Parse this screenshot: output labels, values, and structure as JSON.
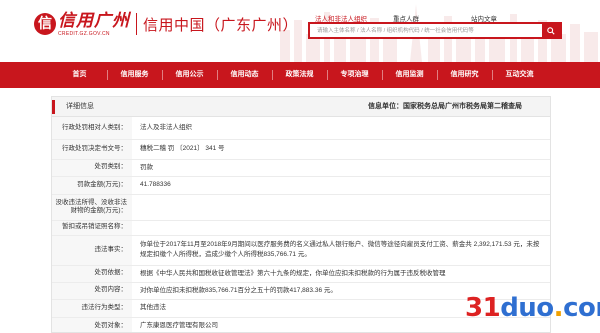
{
  "logo": {
    "badge": "信",
    "main": "信用广州",
    "sub": "CREDIT.GZ.GOV.CN",
    "site_name": "信用中国（广东广州）"
  },
  "search": {
    "tabs": [
      "法人和非法人组织",
      "重点人群",
      "站内文章"
    ],
    "placeholder": "请输入主体名称 / 法人名称 / 组织机构代码 / 统一社会信用代码等"
  },
  "nav": {
    "items": [
      "首页",
      "信用服务",
      "信用公示",
      "信用动态",
      "政策法规",
      "专项治理",
      "信用监测",
      "信用研究",
      "互动交流"
    ]
  },
  "detail": {
    "title": "详细信息",
    "source": "信息单位：国家税务总局广州市税务局第二稽查局",
    "rows": [
      {
        "label": "行政处罚相对人类别：",
        "value": "法人及非法人组织"
      },
      {
        "label": "行政处罚决定书文号：",
        "value": "穗税二稽 罚 〔2021〕 341 号"
      },
      {
        "label": "处罚类别：",
        "value": "罚款"
      },
      {
        "label": "罚款金额(万元)：",
        "value": "41.788336"
      },
      {
        "label": "没收违法所得、没收非法财物的金额(万元)：",
        "value": ""
      },
      {
        "label": "暂扣或吊销证照名称：",
        "value": ""
      },
      {
        "label": "违法事实：",
        "value": "你单位于2017年11月至2018年9月期间以医疗服务费的名义通过私人银行账户、微信等途径向雇员支付工资、薪金共 2,392,171.53 元，未按规定扣缴个人所得税，造成少缴个人所得税835,766.71 元。"
      },
      {
        "label": "处罚依据：",
        "value": "根据《中华人民共和国税收征收管理法》第六十九条的规定，你单位应扣未扣税款的行为属于违反税收管理"
      },
      {
        "label": "处罚内容：",
        "value": "对你单位应扣未扣税款835,766.71百分之五十的罚款417,883.36 元。"
      },
      {
        "label": "违法行为类型：",
        "value": "其他违法"
      },
      {
        "label": "处罚对象：",
        "value": "广东康恩医疗管理有限公司"
      }
    ]
  },
  "watermark": {
    "num": "31",
    "word": "duo",
    "dot": ".",
    "tld": "com"
  },
  "colors": {
    "brand_red": "#c8161d",
    "label_bg": "#f7f7f7",
    "border": "#e3e3e3"
  },
  "icons": {
    "search": "search-icon"
  }
}
